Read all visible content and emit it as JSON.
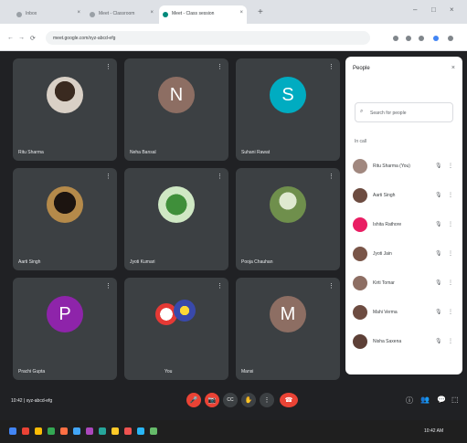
{
  "browser": {
    "tabs": [
      {
        "label": "Inbox",
        "active": false
      },
      {
        "label": "Meet - Classroom",
        "active": false
      },
      {
        "label": "Meet - Class session",
        "active": true
      }
    ],
    "new_tab": "+",
    "window_controls": [
      "–",
      "□",
      "×"
    ],
    "url": "meet.google.com/xyz-abcd-efg",
    "nav": {
      "back": "←",
      "forward": "→",
      "reload": "⟳"
    }
  },
  "tiles": [
    {
      "name": "Ritu Sharma",
      "avatar_type": "photo1",
      "initial": ""
    },
    {
      "name": "Neha Bansal",
      "avatar_type": "initial",
      "initial": "N",
      "color": "#8d6e63"
    },
    {
      "name": "Suhani Rawat",
      "avatar_type": "initial",
      "initial": "S",
      "color": "#00acc1"
    },
    {
      "name": "Aarti Singh",
      "avatar_type": "photo2",
      "initial": ""
    },
    {
      "name": "Jyoti Kumari",
      "avatar_type": "photo3",
      "initial": ""
    },
    {
      "name": "Pooja Chauhan",
      "avatar_type": "photo4",
      "initial": ""
    },
    {
      "name": "Prachi Gupta",
      "avatar_type": "initial",
      "initial": "P",
      "color": "#8e24aa"
    },
    {
      "name": "You",
      "avatar_type": "duo",
      "initial": ""
    },
    {
      "name": "Mansi",
      "avatar_type": "initial",
      "initial": "M",
      "color": "#8d6e63"
    }
  ],
  "tile_more": "⋮",
  "people_panel": {
    "title": "People",
    "close": "×",
    "search_placeholder": "Search for people",
    "section_label": "In call",
    "participants": [
      {
        "name": "Ritu Sharma (You)",
        "color": "#a1887f"
      },
      {
        "name": "Aarti Singh",
        "color": "#6d4c41"
      },
      {
        "name": "Ishita Rathore",
        "color": "#e91e63"
      },
      {
        "name": "Jyoti Jain",
        "color": "#795548"
      },
      {
        "name": "Kirti Tomar",
        "color": "#8d6e63"
      },
      {
        "name": "Mahi Verma",
        "color": "#6d4c41"
      },
      {
        "name": "Nisha Saxena",
        "color": "#5d4037"
      }
    ],
    "mic_glyph": "🎙",
    "more_glyph": "⋮"
  },
  "controls": {
    "meeting_info": "10:42  |  xyz-abcd-efg",
    "center_buttons": [
      {
        "glyph": "🎤",
        "style": "red"
      },
      {
        "glyph": "📷",
        "style": "red"
      },
      {
        "glyph": "CC",
        "style": "gray"
      },
      {
        "glyph": "✋",
        "style": "gray"
      },
      {
        "glyph": "⋮",
        "style": "gray"
      },
      {
        "glyph": "☎",
        "style": "red"
      }
    ],
    "right_buttons": [
      "ⓘ",
      "👥",
      "💬",
      "⬚"
    ]
  },
  "taskbar": {
    "icon_colors": [
      "#4285f4",
      "#ea4335",
      "#fbbc05",
      "#34a853",
      "#ff7043",
      "#42a5f5",
      "#ab47bc",
      "#26a69a",
      "#ffca28",
      "#ef5350",
      "#29b6f6",
      "#66bb6a"
    ],
    "tray_text": "10:42 AM"
  }
}
